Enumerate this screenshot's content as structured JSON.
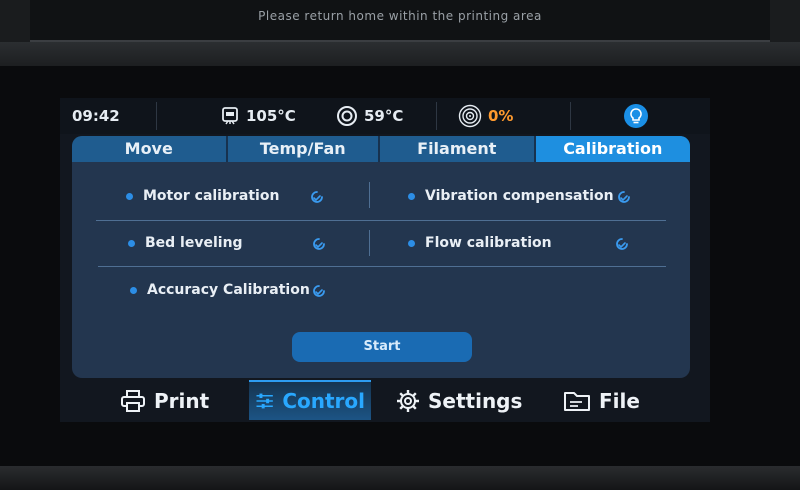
{
  "top_message": "Please return home within the printing area",
  "status": {
    "time": "09:42",
    "bed_temp": "105°C",
    "nozzle_temp": "59°C",
    "fan_percent": "0%",
    "icons": [
      "bed-temp-icon",
      "nozzle-icon",
      "fan-icon",
      "light-bulb-icon"
    ]
  },
  "tabs": [
    {
      "label": "Move"
    },
    {
      "label": "Temp/Fan"
    },
    {
      "label": "Filament"
    },
    {
      "label": "Calibration",
      "active": true
    }
  ],
  "calibration": {
    "items": [
      {
        "label": "Motor calibration"
      },
      {
        "label": "Vibration compensation"
      },
      {
        "label": "Bed leveling"
      },
      {
        "label": "Flow calibration"
      },
      {
        "label": "Accuracy Calibration"
      }
    ],
    "start_label": "Start"
  },
  "nav": [
    {
      "label": "Print",
      "icon": "printer-icon"
    },
    {
      "label": "Control",
      "icon": "sliders-icon",
      "active": true
    },
    {
      "label": "Settings",
      "icon": "gear-icon"
    },
    {
      "label": "File",
      "icon": "folder-icon"
    }
  ],
  "colors": {
    "accent": "#1e8fe0",
    "warning": "#ff9a2e",
    "panel": "#23364f"
  }
}
